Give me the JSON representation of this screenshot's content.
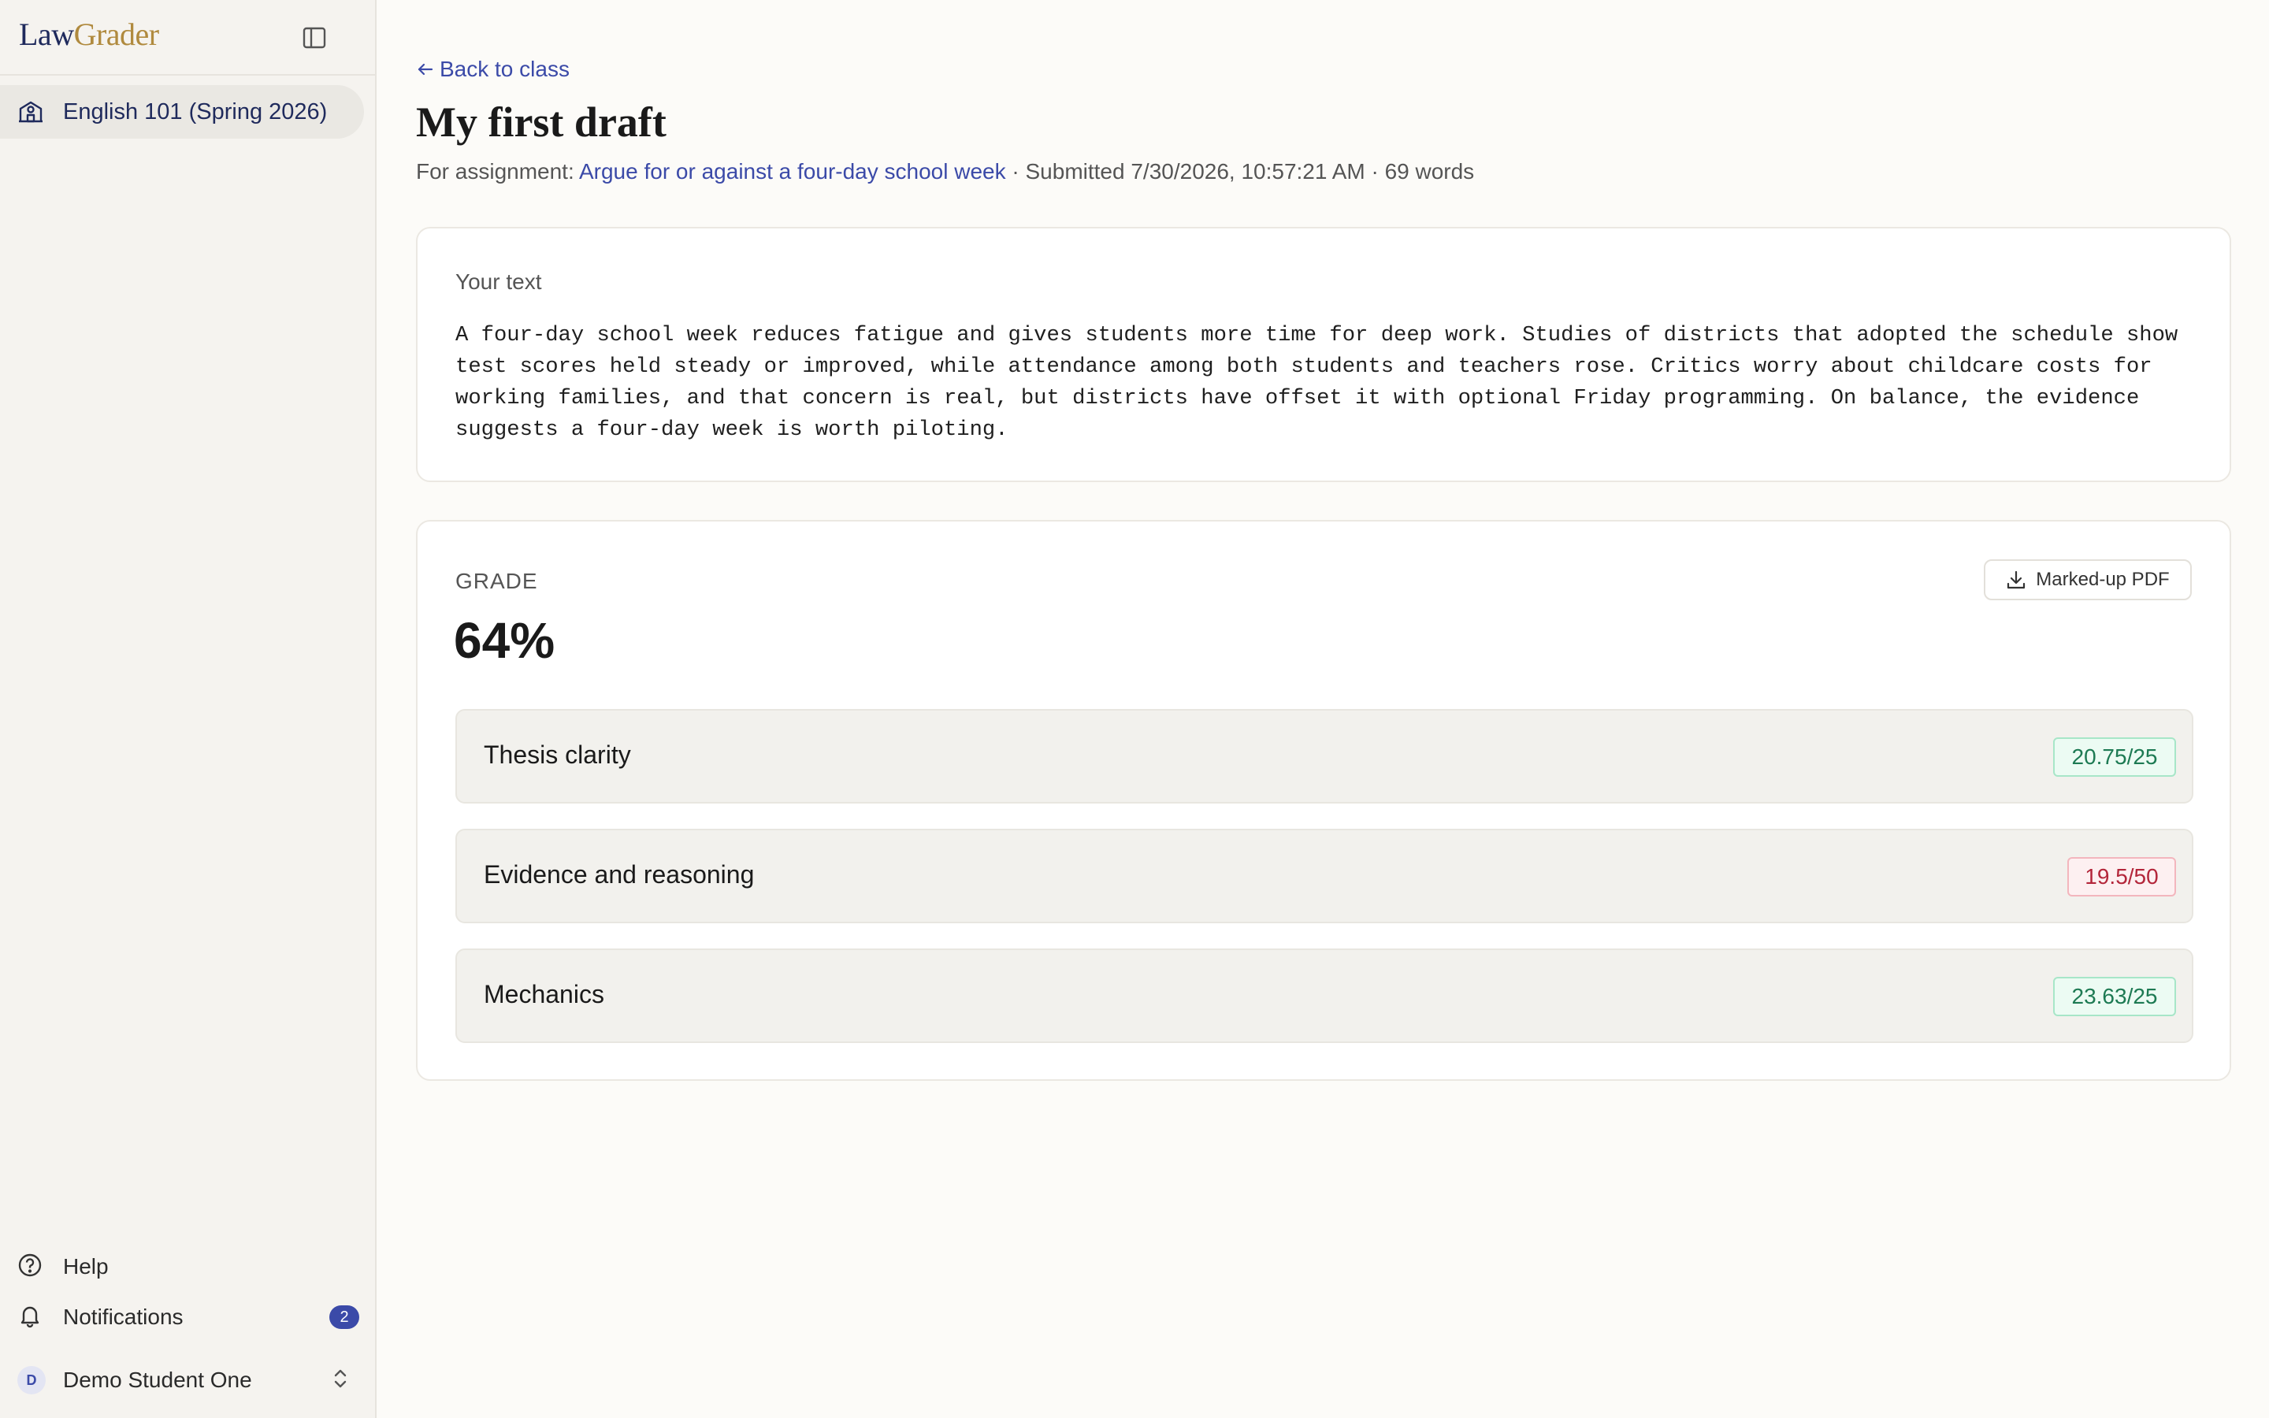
{
  "app": {
    "logo_part1": "Law",
    "logo_part2": "Grader"
  },
  "sidebar": {
    "items": [
      {
        "label": "English 101 (Spring 2026)",
        "icon": "school-icon",
        "active": true
      }
    ],
    "bottom": {
      "help_label": "Help",
      "notifications_label": "Notifications",
      "notifications_count": "2",
      "user_initial": "D",
      "user_name": "Demo Student One"
    }
  },
  "header": {
    "back_label": "Back to class",
    "title": "My first draft",
    "meta_prefix": "For assignment: ",
    "assignment_link": "Argue for or against a four-day school week",
    "meta_suffix": " · Submitted 7/30/2026, 10:57:21 AM · 69 words"
  },
  "text_card": {
    "label": "Your text",
    "body": "A four-day school week reduces fatigue and gives students more time for deep work. Studies of districts that adopted the schedule show test scores held steady or improved, while attendance among both students and teachers rose. Critics worry about childcare costs for working families, and that concern is real, but districts have offset it with optional Friday programming. On balance, the evidence suggests a four-day week is worth piloting."
  },
  "grade_card": {
    "label": "GRADE",
    "value": "64%",
    "pdf_button": "Marked-up PDF",
    "criteria": [
      {
        "name": "Thesis clarity",
        "score": "20.75/25",
        "status": "good"
      },
      {
        "name": "Evidence and reasoning",
        "score": "19.5/50",
        "status": "bad"
      },
      {
        "name": "Mechanics",
        "score": "23.63/25",
        "status": "good"
      }
    ]
  },
  "colors": {
    "accent": "#3b4aa8",
    "logo_navy": "#1f2a5c",
    "logo_gold": "#b08a3e",
    "good": "#1d7a53",
    "bad": "#b3263a"
  }
}
